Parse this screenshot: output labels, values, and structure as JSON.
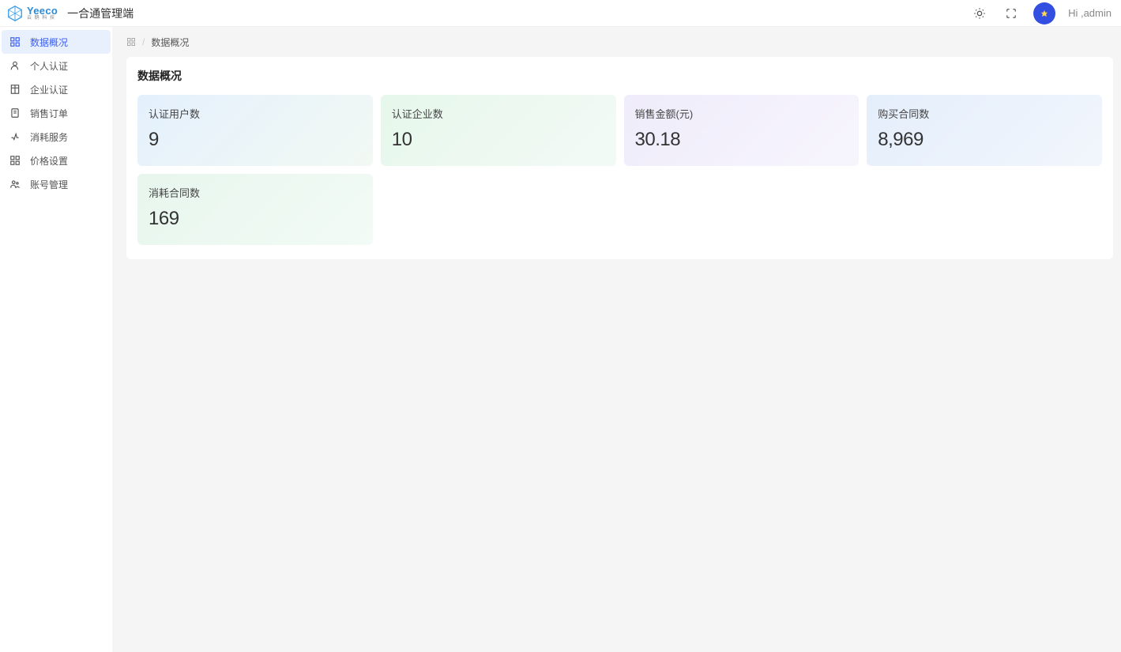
{
  "header": {
    "brand_text": "Yeeco",
    "brand_sub": "云 鹅 科 技",
    "app_title": "一合通管理端",
    "greeting": "Hi ,admin"
  },
  "sidebar": {
    "items": [
      {
        "label": "数据概况",
        "icon": "dashboard-icon",
        "active": true
      },
      {
        "label": "个人认证",
        "icon": "user-icon",
        "active": false
      },
      {
        "label": "企业认证",
        "icon": "building-icon",
        "active": false
      },
      {
        "label": "销售订单",
        "icon": "order-icon",
        "active": false
      },
      {
        "label": "消耗服务",
        "icon": "service-icon",
        "active": false
      },
      {
        "label": "价格设置",
        "icon": "price-icon",
        "active": false
      },
      {
        "label": "账号管理",
        "icon": "account-icon",
        "active": false
      }
    ]
  },
  "breadcrumb": {
    "current": "数据概况"
  },
  "overview": {
    "title": "数据概况",
    "cards": [
      {
        "label": "认证用户数",
        "value": "9",
        "color": "blue"
      },
      {
        "label": "认证企业数",
        "value": "10",
        "color": "green"
      },
      {
        "label": "销售金额(元)",
        "value": "30.18",
        "color": "purple"
      },
      {
        "label": "购买合同数",
        "value": "8,969",
        "color": "blue2"
      },
      {
        "label": "消耗合同数",
        "value": "169",
        "color": "green2"
      }
    ]
  }
}
